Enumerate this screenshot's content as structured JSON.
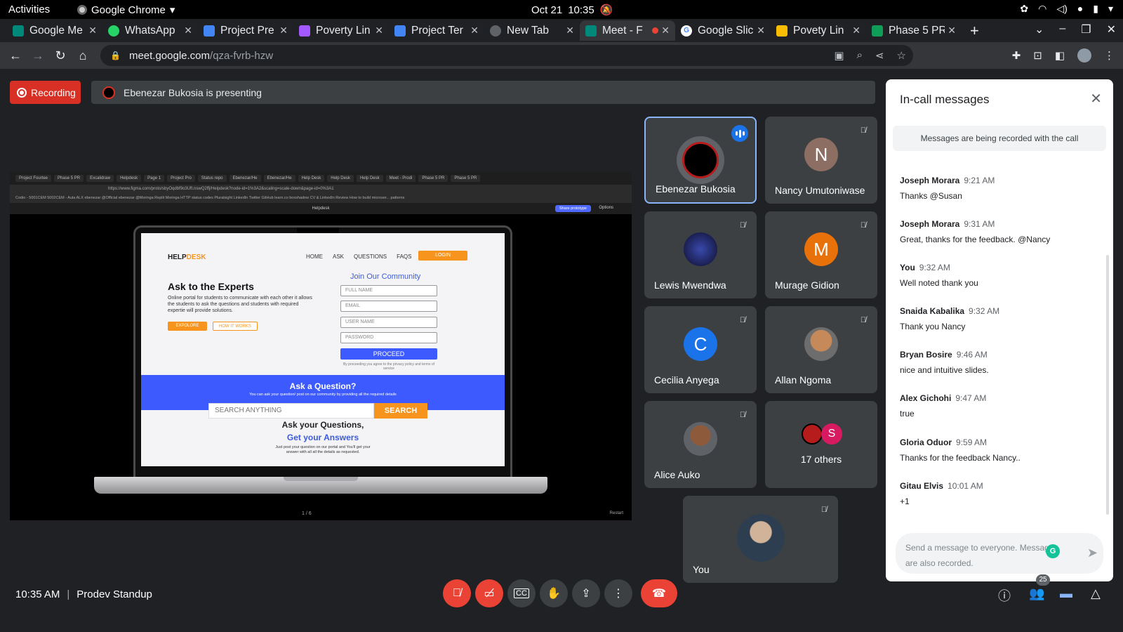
{
  "os_bar": {
    "activities": "Activities",
    "app_name": "Google Chrome",
    "date": "Oct 21",
    "time": "10:35"
  },
  "tabs": [
    {
      "label": "Google Me",
      "color": "#4285f4"
    },
    {
      "label": "WhatsApp",
      "color": "#25d366"
    },
    {
      "label": "Project Pre",
      "color": "#4285f4"
    },
    {
      "label": "Poverty Lin",
      "color": "#a259ff"
    },
    {
      "label": "Project Ter",
      "color": "#4285f4"
    },
    {
      "label": "New Tab",
      "color": "#5f6368"
    },
    {
      "label": "Meet - F",
      "color": "#00897b",
      "active": true
    },
    {
      "label": "Google Slic",
      "color": "#fbbc04"
    },
    {
      "label": "Povety Lin",
      "color": "#fbbc04"
    },
    {
      "label": "Phase 5 PR",
      "color": "#0f9d58"
    }
  ],
  "url": {
    "host": "meet.google.com",
    "path": "/qza-fvrb-hzw"
  },
  "meet": {
    "recording_label": "Recording",
    "presenting_text": "Ebenezar Bukosia is presenting",
    "meeting_time": "10:35 AM",
    "meeting_name": "Prodev Standup",
    "participant_count": "25"
  },
  "presentation": {
    "browser_tabs": [
      "Project Fourtee",
      "Phase 5 PR",
      "Excalidraw",
      "Helpdesk",
      "Page 1",
      "Project Pro",
      "Status repo",
      "Ebenezar/He",
      "Ebenezar/He",
      "Help Desk",
      "Help Desk",
      "Help Desk",
      "Meet - Prodi",
      "Phase 5 PR",
      "Phase 5 PR"
    ],
    "url": "https://www.figma.com/proto/sbyOqdbf9o3Uft.nswQ2ffj/Helpdesk?node-id=1%3A2&scaling=scale-down&page-id=0%3A1",
    "bookmarks": "Codio - 5001CEM   5002CEM - Aula   ALX   ebenezar @Official   ebenezar @Moringa   Replit   Moringa   HTTP status codes   Pluralsight   LinkedIn   Twitter   GitHub   learn.co   boxshadow   CV & LinkedIn Review   How to build microser...   patterns",
    "figma_title": "Helpdesk",
    "share_label": "Share prototype",
    "options_label": "Options",
    "pager": "1 / 6",
    "restart": "Restart",
    "helpdesk": {
      "logo_main": "HELP",
      "logo_accent": "DESK",
      "nav": [
        "HOME",
        "ASK",
        "QUESTIONS",
        "FAQS"
      ],
      "login": "LOGIN",
      "hero_title": "Ask to the Experts",
      "hero_desc": "Online portal for students to communicate with each other it allows the students to ask the questions and students with required expertie will provide solutions.",
      "explore": "EXPOLORE",
      "how": "HOW IT WORKS",
      "join": "Join Our Community",
      "fields": [
        "FULL NAME",
        "EMAIL",
        "USER NAME",
        "PASSWORD"
      ],
      "proceed": "PROCEED",
      "terms": "By proceeding you agree to the privacy policy and terms of service",
      "banner_title": "Ask a Question?",
      "banner_sub": "You can ask your question/ post on our community by providing all the required details",
      "search_placeholder": "SEARCH ANYTHING",
      "search_btn": "SEARCH",
      "ask_line": "Ask your Questions,",
      "answers_line": "Get your Answers",
      "foot": "Just post your question on our portal and You'll get your answer with all all the details as requested."
    }
  },
  "participants": [
    {
      "name": "Ebenezar Bukosia",
      "speaking": true
    },
    {
      "name": "Nancy Umutoniwase",
      "initial": "N",
      "color": "#8d6e63"
    },
    {
      "name": "Lewis Mwendwa"
    },
    {
      "name": "Murage Gidion",
      "initial": "M",
      "color": "#e8710a"
    },
    {
      "name": "Cecilia Anyega",
      "initial": "C",
      "color": "#1a73e8"
    },
    {
      "name": "Allan Ngoma"
    },
    {
      "name": "Alice Auko"
    },
    {
      "name": "17 others",
      "initial": "S",
      "color": "#d81b60"
    },
    {
      "name": "You"
    }
  ],
  "chat": {
    "title": "In-call messages",
    "notice": "Messages are being recorded with the call",
    "messages": [
      {
        "sender": "Joseph Morara",
        "time": "9:21 AM",
        "text": "Thanks @Susan"
      },
      {
        "sender": "Joseph Morara",
        "time": "9:31 AM",
        "text": "Great, thanks for the feedback. @Nancy"
      },
      {
        "sender": "You",
        "time": "9:32 AM",
        "text": "Well noted thank you"
      },
      {
        "sender": "Snaida Kabalika",
        "time": "9:32 AM",
        "text": "Thank you Nancy"
      },
      {
        "sender": "Bryan Bosire",
        "time": "9:46 AM",
        "text": "nice and intuitive slides."
      },
      {
        "sender": "Alex Gichohi",
        "time": "9:47 AM",
        "text": "true"
      },
      {
        "sender": "Gloria Oduor",
        "time": "9:59 AM",
        "text": "Thanks for the feedback Nancy.."
      },
      {
        "sender": "Gitau Elvis",
        "time": "10:01 AM",
        "text": "+1"
      }
    ],
    "placeholder": "Send a message to everyone. Messages are also recorded."
  },
  "icons": {
    "grammarly": "G",
    "accent_red": "#ea4335",
    "accent_blue": "#8ab4f8"
  }
}
